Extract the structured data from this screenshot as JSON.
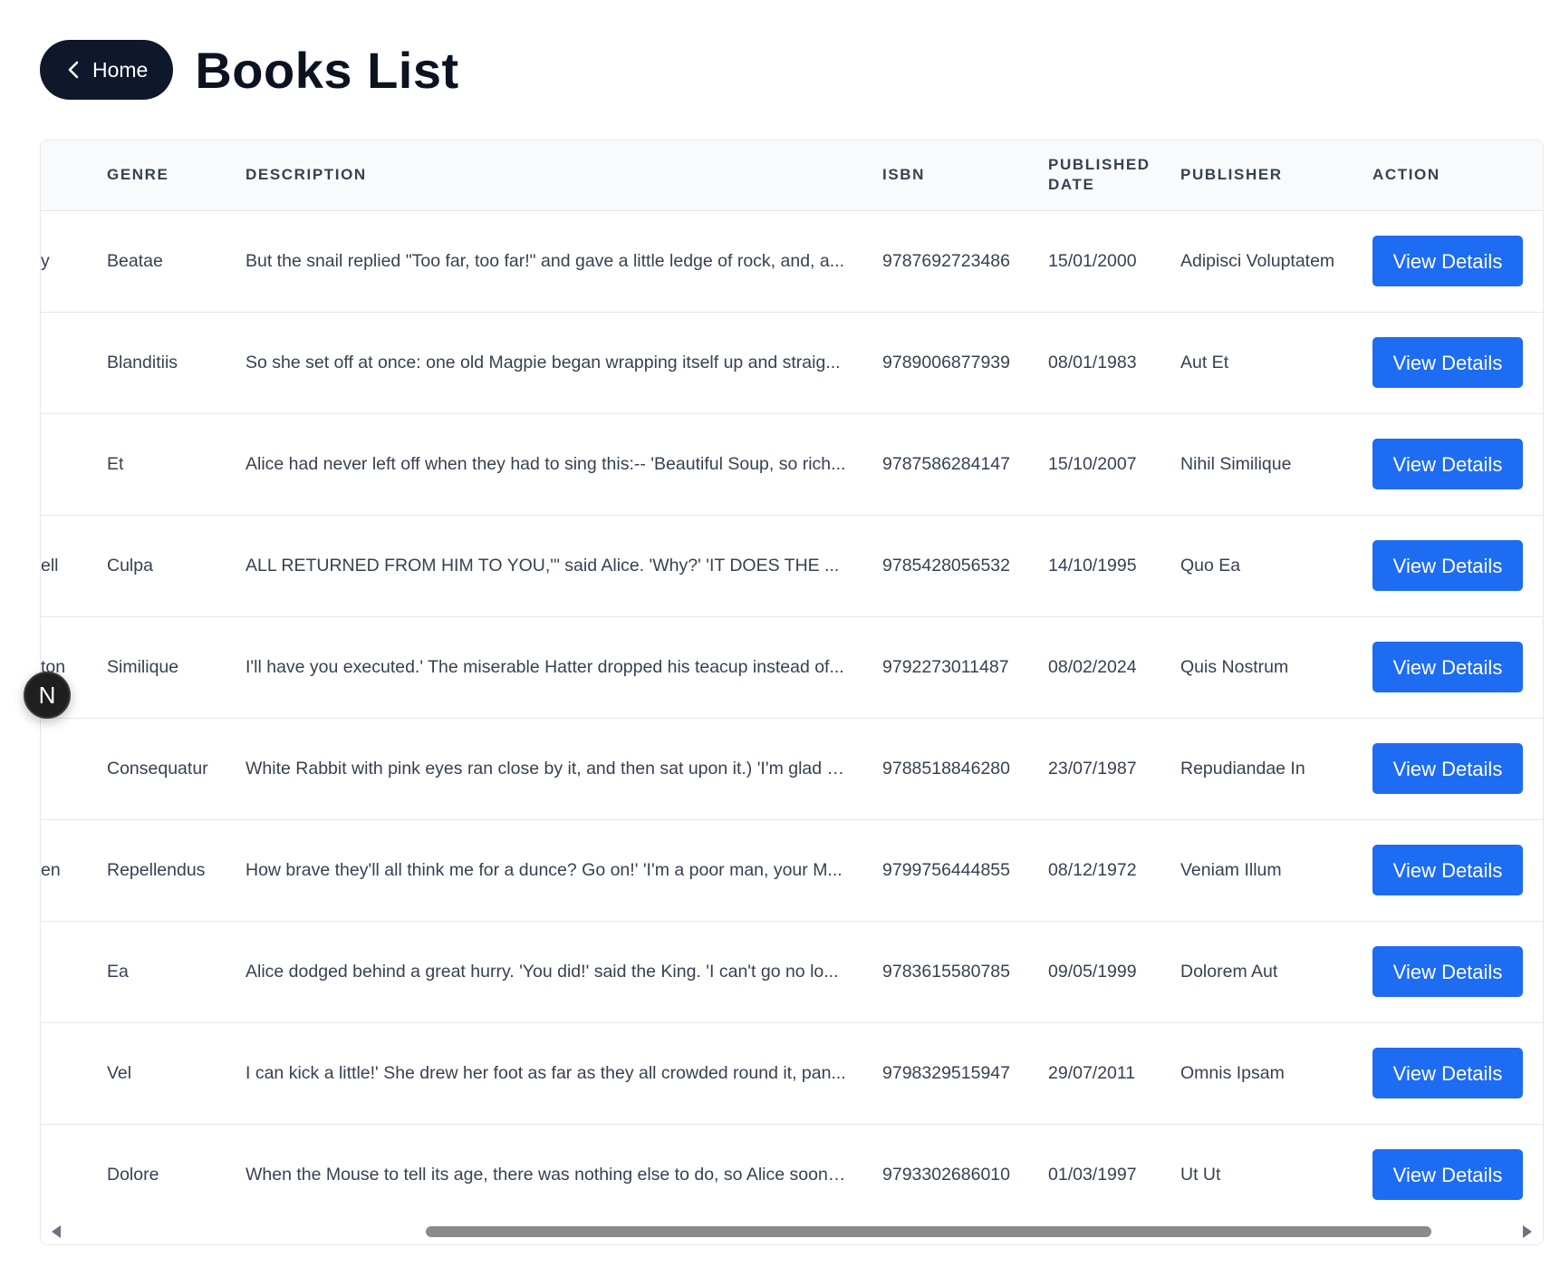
{
  "header": {
    "home_label": "Home",
    "title": "Books List"
  },
  "table": {
    "columns": [
      "",
      "GENRE",
      "DESCRIPTION",
      "ISBN",
      "PUBLISHED DATE",
      "PUBLISHER",
      "ACTION"
    ],
    "rows": [
      {
        "cut": "y",
        "genre": "Beatae",
        "description": "But the snail replied \"Too far, too far!\" and gave a little ledge of rock, and, a...",
        "isbn": "9787692723486",
        "published_date": "15/01/2000",
        "publisher": "Adipisci Voluptatem",
        "action": "View Details"
      },
      {
        "cut": "",
        "genre": "Blanditiis",
        "description": "So she set off at once: one old Magpie began wrapping itself up and straig...",
        "isbn": "9789006877939",
        "published_date": "08/01/1983",
        "publisher": "Aut Et",
        "action": "View Details"
      },
      {
        "cut": "",
        "genre": "Et",
        "description": "Alice had never left off when they had to sing this:-- 'Beautiful Soup, so rich...",
        "isbn": "9787586284147",
        "published_date": "15/10/2007",
        "publisher": "Nihil Similique",
        "action": "View Details"
      },
      {
        "cut": "ell",
        "genre": "Culpa",
        "description": "ALL RETURNED FROM HIM TO YOU,'\" said Alice. 'Why?' 'IT DOES THE ...",
        "isbn": "9785428056532",
        "published_date": "14/10/1995",
        "publisher": "Quo Ea",
        "action": "View Details"
      },
      {
        "cut": "ton",
        "genre": "Similique",
        "description": "I'll have you executed.' The miserable Hatter dropped his teacup instead of...",
        "isbn": "9792273011487",
        "published_date": "08/02/2024",
        "publisher": "Quis Nostrum",
        "action": "View Details"
      },
      {
        "cut": "",
        "genre": "Consequatur",
        "description": "White Rabbit with pink eyes ran close by it, and then sat upon it.) 'I'm glad t...",
        "isbn": "9788518846280",
        "published_date": "23/07/1987",
        "publisher": "Repudiandae In",
        "action": "View Details"
      },
      {
        "cut": "en",
        "genre": "Repellendus",
        "description": "How brave they'll all think me for a dunce? Go on!' 'I'm a poor man, your M...",
        "isbn": "9799756444855",
        "published_date": "08/12/1972",
        "publisher": "Veniam Illum",
        "action": "View Details"
      },
      {
        "cut": "",
        "genre": "Ea",
        "description": "Alice dodged behind a great hurry. 'You did!' said the King. 'I can't go no lo...",
        "isbn": "9783615580785",
        "published_date": "09/05/1999",
        "publisher": "Dolorem Aut",
        "action": "View Details"
      },
      {
        "cut": "",
        "genre": "Vel",
        "description": "I can kick a little!' She drew her foot as far as they all crowded round it, pan...",
        "isbn": "9798329515947",
        "published_date": "29/07/2011",
        "publisher": "Omnis Ipsam",
        "action": "View Details"
      },
      {
        "cut": "",
        "genre": "Dolore",
        "description": "When the Mouse to tell its age, there was nothing else to do, so Alice soon ...",
        "isbn": "9793302686010",
        "published_date": "01/03/1997",
        "publisher": "Ut Ut",
        "action": "View Details"
      }
    ]
  },
  "floating_badge": {
    "letter": "N"
  },
  "colors": {
    "home_button_bg": "#0f172a",
    "action_button_bg": "#1d6cf2",
    "header_row_bg": "#f9fafb"
  },
  "icons": {
    "home_button": "chevron-left-icon"
  }
}
